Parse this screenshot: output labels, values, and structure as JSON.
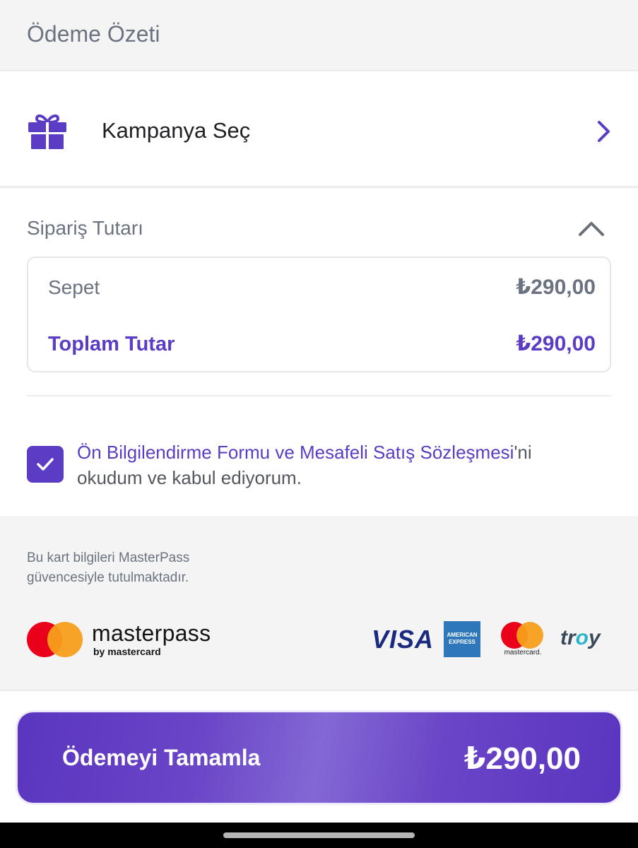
{
  "header": {
    "title": "Ödeme Özeti"
  },
  "campaign": {
    "label": "Kampanya Seç",
    "icon": "gift-icon",
    "accent": "#5b3cc4"
  },
  "order": {
    "title": "Sipariş Tutarı",
    "rows": [
      {
        "label": "Sepet",
        "value": "₺290,00"
      },
      {
        "label": "Toplam Tutar",
        "value": "₺290,00"
      }
    ]
  },
  "consent": {
    "checked": true,
    "link_text": "Ön Bilgilendirme Formu ve Mesafeli Satış Sözleşmesi",
    "suffix_1": "'ni",
    "suffix_2": "okudum ve kabul ediyorum."
  },
  "masterpass": {
    "note_line1": "Bu kart bilgileri MasterPass",
    "note_line2": "güvencesiyle tutulmaktadır.",
    "brand": "masterpass",
    "brand_sub": "by mastercard"
  },
  "card_logos": {
    "visa": "VISA",
    "amex_line1": "AMERICAN",
    "amex_line2": "EXPRESS",
    "mastercard": "mastercard.",
    "troy_t": "tr",
    "troy_o": "o",
    "troy_y": "y"
  },
  "pay_button": {
    "label": "Ödemeyi Tamamla",
    "amount": "₺290,00"
  },
  "colors": {
    "primary": "#5b3cc4",
    "muted_text": "#6b7280"
  }
}
